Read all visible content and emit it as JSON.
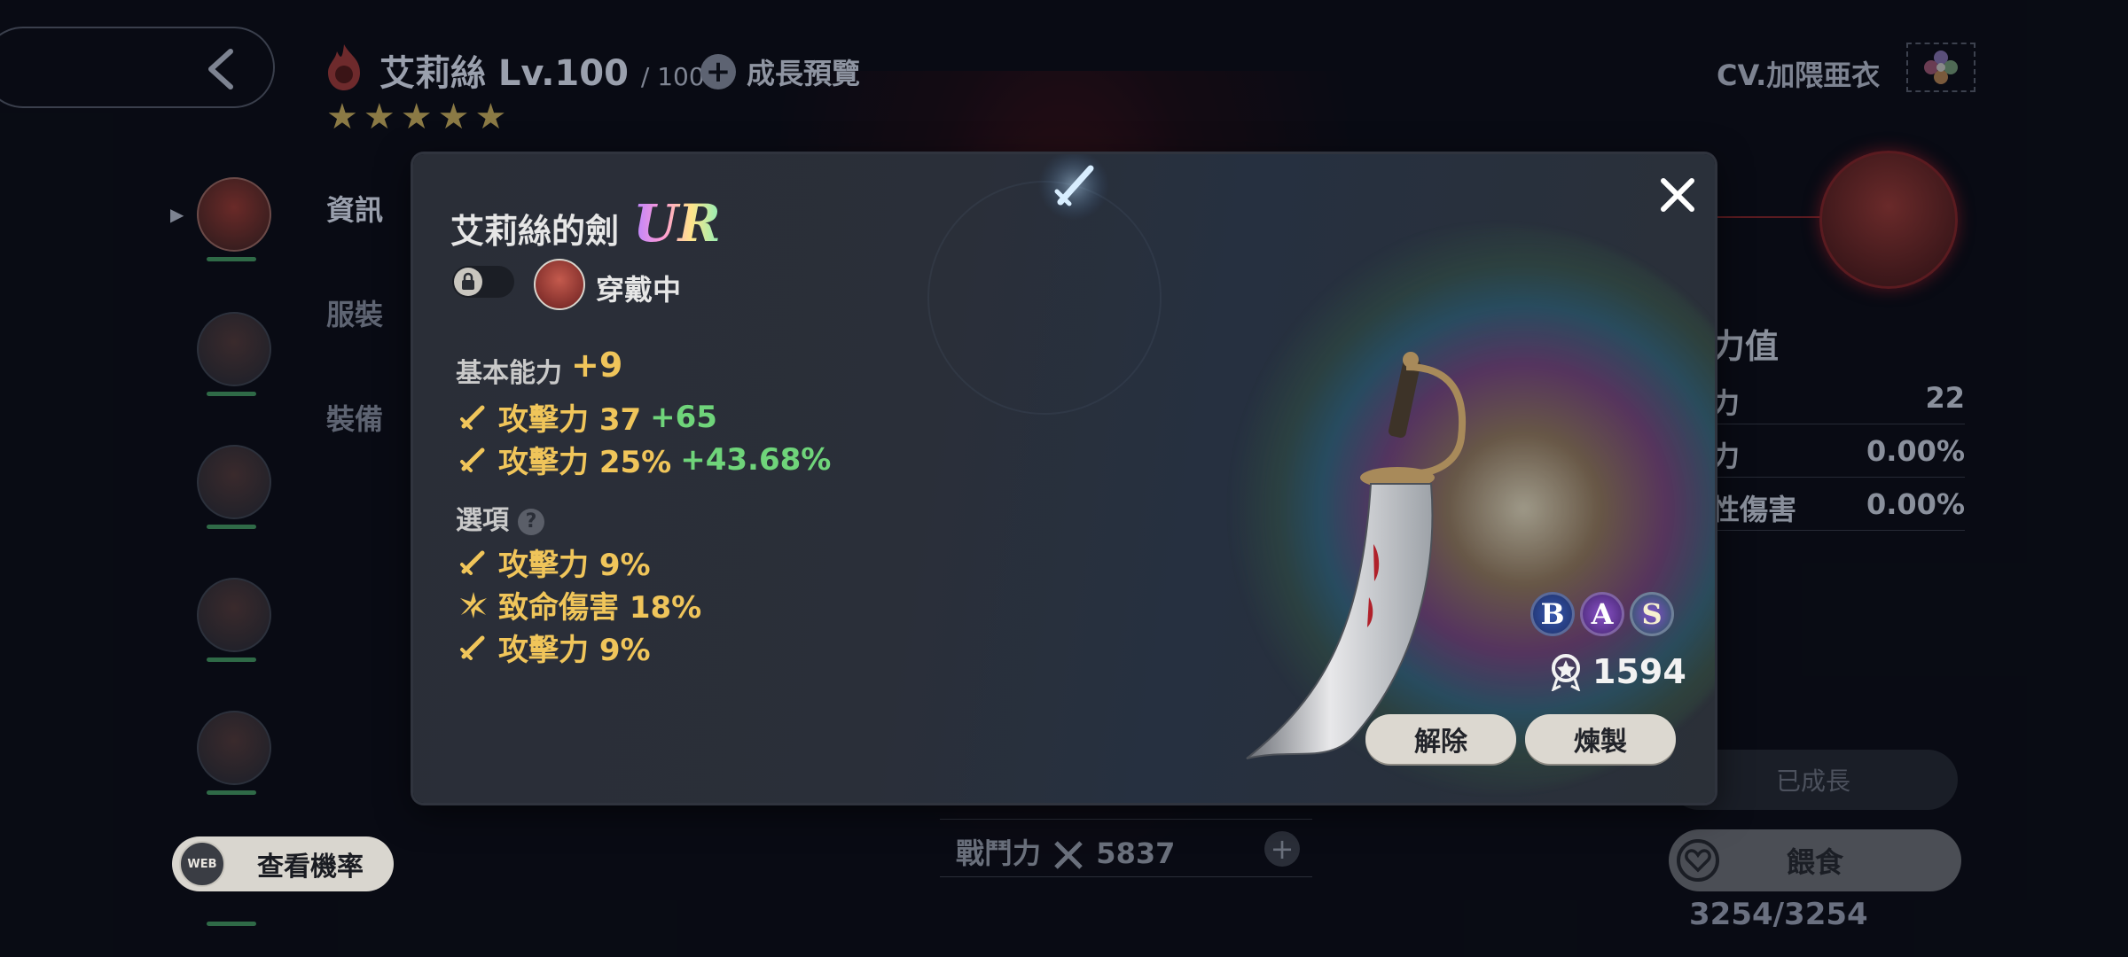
{
  "header": {
    "character_name": "艾莉絲 Lv.100",
    "level_max": "/ 100",
    "growth_preview_label": "成長預覽",
    "star_count": 5,
    "cv_label": "CV.加隈亜衣"
  },
  "sidebar": {
    "tabs": [
      {
        "label": "資訊"
      },
      {
        "label": "服裝"
      },
      {
        "label": "裝備"
      }
    ]
  },
  "stats_panel": {
    "heading": "力值",
    "rows": [
      {
        "label": "力",
        "value": "22"
      },
      {
        "label": "力",
        "value": "0.00%"
      },
      {
        "label": "性傷害",
        "value": "0.00%"
      }
    ],
    "grown_label": "已成長",
    "feed_label": "餵食",
    "feed_count": "3254/3254"
  },
  "power": {
    "label": "戰鬥力",
    "value": "5837"
  },
  "view_rate": {
    "web_badge": "WEB",
    "label": "查看機率"
  },
  "modal": {
    "item_name": "艾莉絲的劍",
    "rarity": "UR",
    "equipped_label": "穿戴中",
    "base_label": "基本能力",
    "base_bonus": "+9",
    "base_stats": [
      {
        "icon": "sword-icon",
        "text": "攻擊力 37",
        "bonus": "+65"
      },
      {
        "icon": "sword-icon",
        "text": "攻擊力 25%",
        "bonus": "+43.68%"
      }
    ],
    "options_label": "選項",
    "options": [
      {
        "icon": "sword-icon",
        "text": "攻擊力 9%"
      },
      {
        "icon": "critical-burst-icon",
        "text": "致命傷害 18%"
      },
      {
        "icon": "sword-icon",
        "text": "攻擊力 9%"
      }
    ],
    "grades": [
      "B",
      "A",
      "S"
    ],
    "combat_value": "1594",
    "unequip_label": "解除",
    "refine_label": "煉製"
  },
  "colors": {
    "gold": "#f0c55a",
    "green_bonus": "#6fd47a",
    "modal_bg": "#2a2e37",
    "button_bg": "#dcd8d0"
  }
}
